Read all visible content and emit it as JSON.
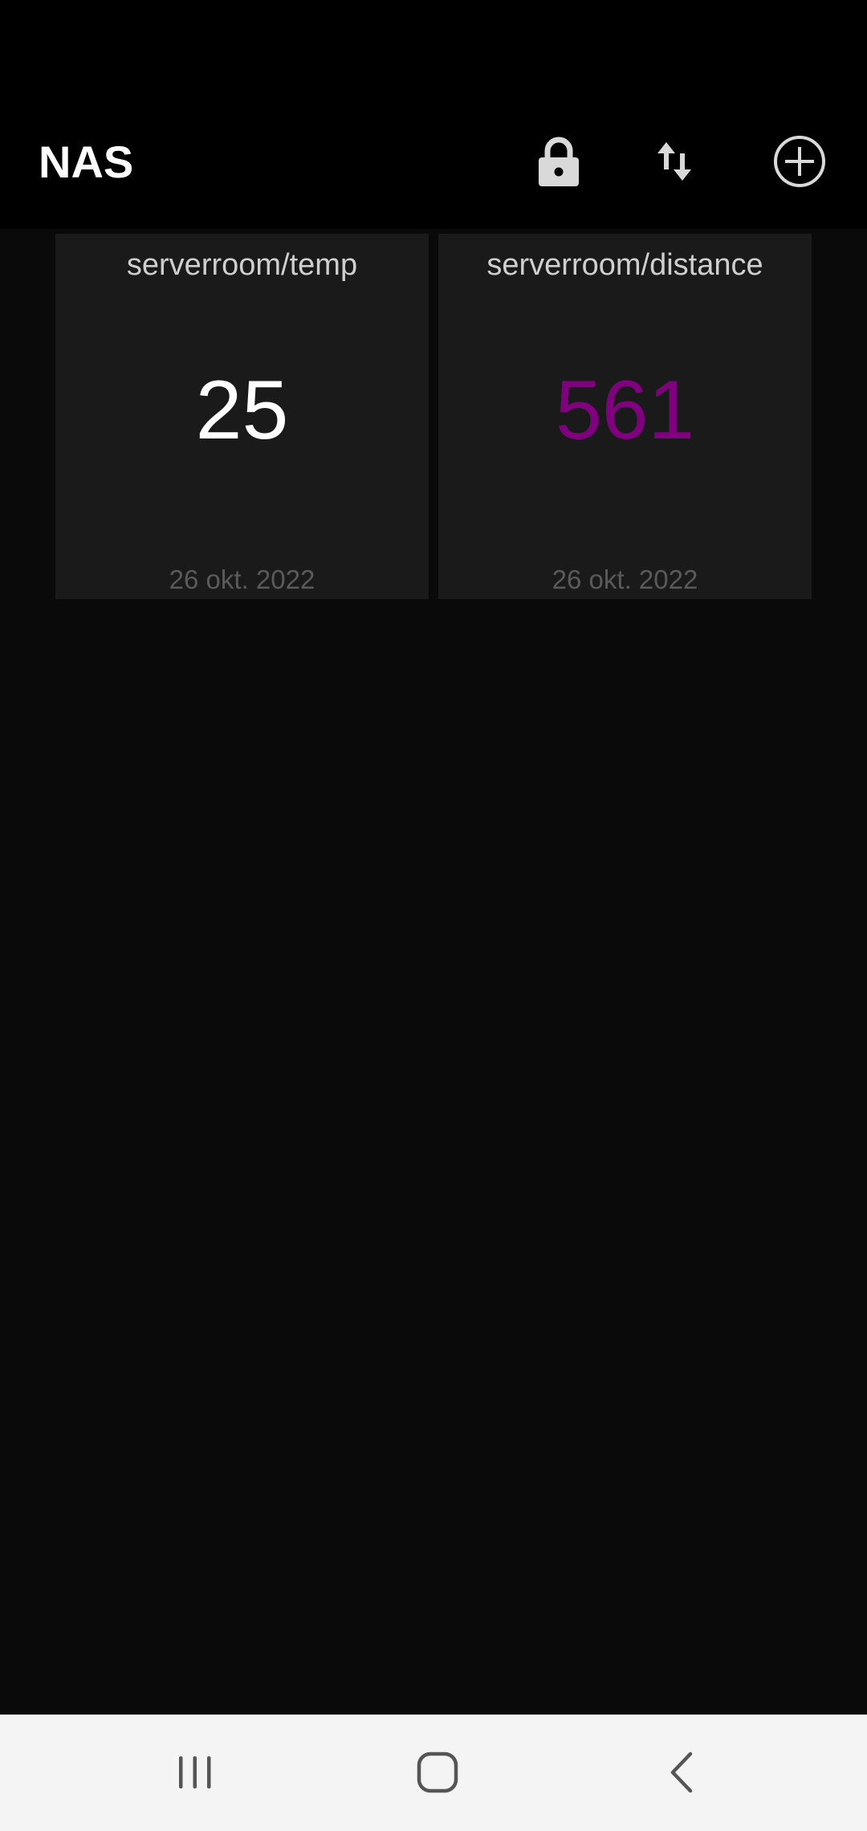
{
  "app_bar": {
    "title": "NAS",
    "icons": [
      "lock-icon",
      "swap-vertical-icon",
      "add-circle-icon"
    ]
  },
  "tiles": [
    {
      "topic": "serverroom/temp",
      "value": "25",
      "date": "26 okt. 2022",
      "value_color": "#ffffff"
    },
    {
      "topic": "serverroom/distance",
      "value": "561",
      "date": "26 okt. 2022",
      "value_color": "#800080"
    }
  ],
  "nav_bar": {
    "icons": [
      "recents-icon",
      "home-icon",
      "back-icon"
    ]
  },
  "colors": {
    "background": "#0a0a0a",
    "app_bar": "#000000",
    "tile": "#1a1a1a",
    "accent_purple": "#800080",
    "nav_bar": "#f4f4f4"
  }
}
